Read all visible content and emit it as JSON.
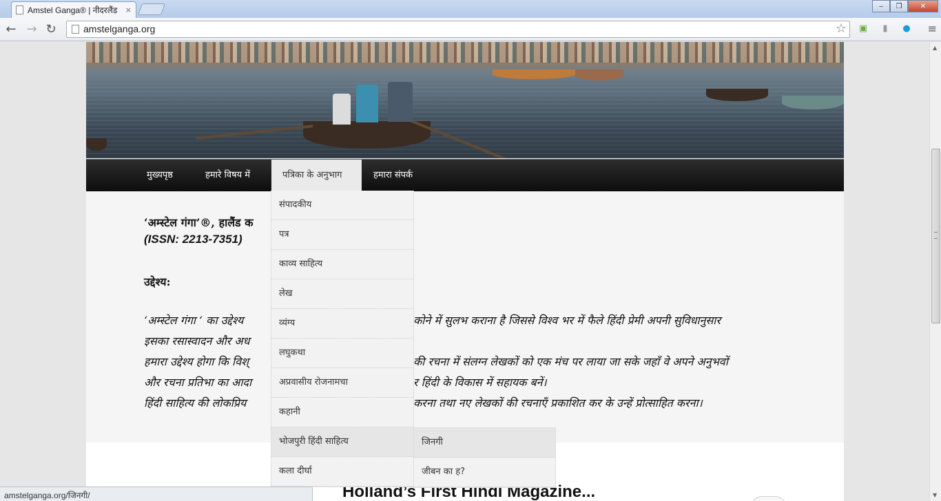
{
  "browser": {
    "tab_title": "Amstel Ganga® | नीदरलैंड",
    "tab_close": "×",
    "url": "amstelganga.org",
    "status_url": "amstelganga.org/जिनगी/"
  },
  "nav": {
    "items": [
      "मुख्यपृष्ठ",
      "हमारे विषय में",
      "पत्रिका के अनुभाग",
      "हमारा संपर्क"
    ],
    "active": "पत्रिका के अनुभाग"
  },
  "dropdown": {
    "items": [
      "संपादकीय",
      "पत्र",
      "काव्य साहित्य",
      "लेख",
      "व्यंग्य",
      "लघुकथा",
      "अप्रवासीय रोजनामचा",
      "कहानी",
      "भोजपुरी हिंदी साहित्य",
      "कला दीर्घा"
    ],
    "hovered": "भोजपुरी हिंदी साहित्य"
  },
  "subdropdown": {
    "items": [
      "जिनगी",
      "जीबन का ह?"
    ]
  },
  "content": {
    "title_line": "‘अम्स्टेल गंगा’®, हालैंड क",
    "issn": "(ISSN: 2213-7351)",
    "heading": "उद्देश्य:",
    "para1_a": "‘अम्स्टेल गंगा ‘ का उद्देश्य ",
    "para1_b": "कोने में सुलभ कराना है जिससे विश्व भर में फैले हिंदी प्रेमी अपनी सुविधानुसार",
    "para2": "इसका रसास्वादन और अध",
    "para3_a": "हमारा उद्देश्य होगा कि विश्",
    "para3_b": "की रचना में संलग्न लेखकों को एक मंच पर लाया जा सके जहाँ वे अपने अनुभवों",
    "para4_a": "और रचना प्रतिभा का आदा",
    "para4_b": "र हिंदी के विकास में सहायक बनें।",
    "para5_a": "हिंदी साहित्य की लोकप्रिय",
    "para5_b": "करना तथा नए लेखकों की रचनाएँ प्रकाशित कर के उन्हें प्रोत्साहित करना।"
  },
  "lower": {
    "headline": "Holland’s First Hindi Magazine..."
  }
}
